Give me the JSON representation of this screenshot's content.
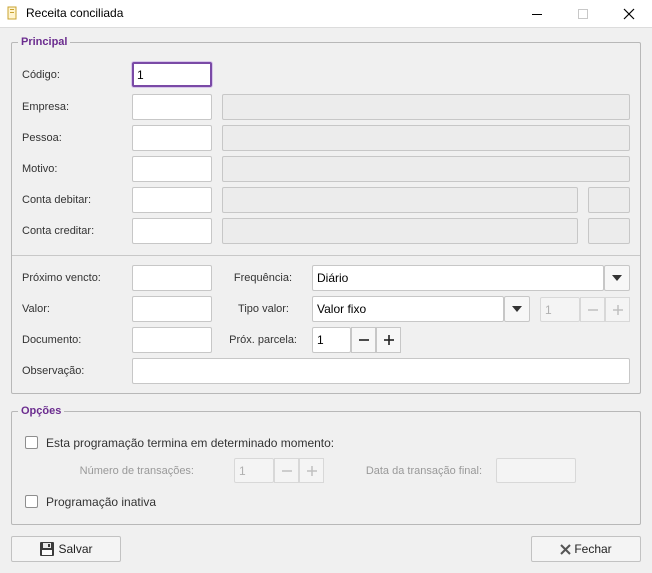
{
  "window": {
    "title": "Receita conciliada"
  },
  "principal": {
    "legend": "Principal",
    "codigo": {
      "label": "Código:",
      "value": "1"
    },
    "empresa": {
      "label": "Empresa:"
    },
    "pessoa": {
      "label": "Pessoa:"
    },
    "motivo": {
      "label": "Motivo:"
    },
    "conta_debitar": {
      "label": "Conta debitar:"
    },
    "conta_creditar": {
      "label": "Conta creditar:"
    },
    "proximo_vencto": {
      "label": "Próximo vencto:"
    },
    "frequencia": {
      "label": "Frequência:",
      "value": "Diário"
    },
    "valor": {
      "label": "Valor:"
    },
    "tipo_valor": {
      "label": "Tipo valor:",
      "value": "Valor fixo",
      "spinner_value": "1"
    },
    "documento": {
      "label": "Documento:"
    },
    "prox_parcela": {
      "label": "Próx. parcela:",
      "value": "1"
    },
    "observacao": {
      "label": "Observação:"
    }
  },
  "opcoes": {
    "legend": "Opções",
    "termina": {
      "label": "Esta programação termina em determinado momento:",
      "checked": false
    },
    "num_transacoes": {
      "label": "Número de transações:",
      "value": "1"
    },
    "data_final": {
      "label": "Data da transação final:"
    },
    "inativa": {
      "label": "Programação inativa",
      "checked": false
    }
  },
  "buttons": {
    "salvar": "Salvar",
    "fechar": "Fechar"
  },
  "colors": {
    "accent": "#6b2c8f",
    "focus": "#7a4aa6"
  }
}
